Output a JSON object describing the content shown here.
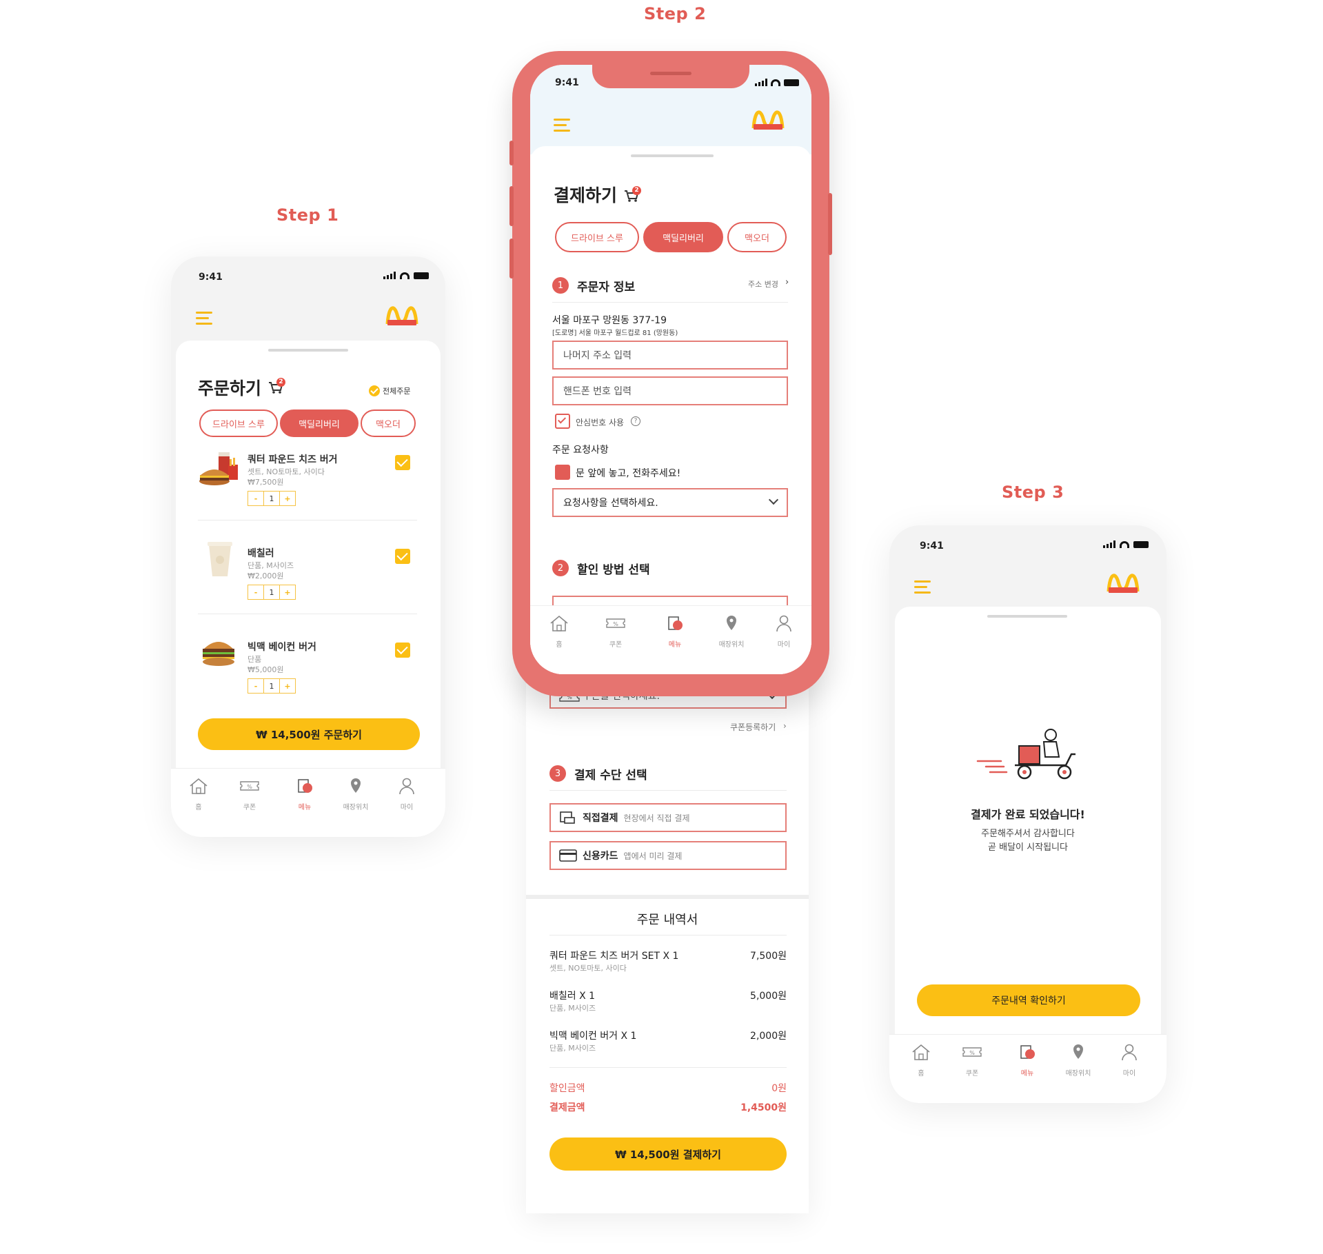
{
  "steps": [
    "Step 1",
    "Step 2",
    "Step 3"
  ],
  "status_time": "9:41",
  "tabs": [
    "홈",
    "쿠폰",
    "메뉴",
    "매장위치",
    "마이"
  ],
  "order_types": [
    "드라이브 스루",
    "맥딜리버리",
    "맥오더"
  ],
  "step1": {
    "title": "주문하기",
    "cart_count": "2",
    "select_all": "전체주문",
    "items": [
      {
        "name": "쿼터 파운드 치즈 버거",
        "options": "셋트, NO토마토, 사이다",
        "price": "₩7,500원",
        "qty": "1"
      },
      {
        "name": "배칠러",
        "options": "단품, M사이즈",
        "price": "₩2,000원",
        "qty": "1"
      },
      {
        "name": "빅맥 베이컨 버거",
        "options": "단품",
        "price": "₩5,000원",
        "qty": "1"
      }
    ],
    "minus": "-",
    "plus": "+",
    "order_button": "₩ 14,500원 주문하기"
  },
  "step2": {
    "title": "결제하기",
    "cart_count": "2",
    "section1_num": "1",
    "section1_title": "주문자 정보",
    "address_change": "주소 변경",
    "address_main": "서울 마포구 망원동 377-19",
    "address_road": "[도로명] 서울 마포구 월드컵로 81 (망원동)",
    "address_detail_placeholder": "나머지 주소 입력",
    "phone_placeholder": "핸드폰 번호 입력",
    "safe_number": "안심번호 사용",
    "request_label": "주문 요청사항",
    "request_check": "문 앞에 놓고, 전화주세요!",
    "request_select": "요청사항을 선택하세요.",
    "section2_num": "2",
    "section2_title": "할인 방법 선택",
    "coupon_select": "쿠폰을 선택하세요.",
    "coupon_register": "쿠폰등록하기",
    "section3_num": "3",
    "section3_title": "결제 수단 선택",
    "payment": [
      {
        "name": "직접결제",
        "desc": "현장에서 직접 결제"
      },
      {
        "name": "신용카드",
        "desc": "앱에서 미리 결제"
      }
    ],
    "receipt_title": "주문 내역서",
    "receipt_items": [
      {
        "name": "쿼터 파운드 치즈 버거 SET X 1",
        "options": "셋트, NO토마토, 사이다",
        "price": "7,500원"
      },
      {
        "name": "배칠러 X 1",
        "options": "단품, M사이즈",
        "price": "5,000원"
      },
      {
        "name": "빅맥 베이컨 버거 X 1",
        "options": "단품, M사이즈",
        "price": "2,000원"
      }
    ],
    "discount_label": "할인금액",
    "discount_value": "0원",
    "total_label": "결제금액",
    "total_value": "1,4500원",
    "pay_button": "₩ 14,500원 결제하기"
  },
  "step3": {
    "message_title": "결제가 완료 되었습니다!",
    "message_line1": "주문해주셔서 감사합니다",
    "message_line2": "곧 배달이 시작됩니다",
    "confirm_button": "주문내역 확인하기"
  },
  "colors": {
    "accent": "#e25c56",
    "yellow": "#fbbf14",
    "frame": "#e67470"
  }
}
